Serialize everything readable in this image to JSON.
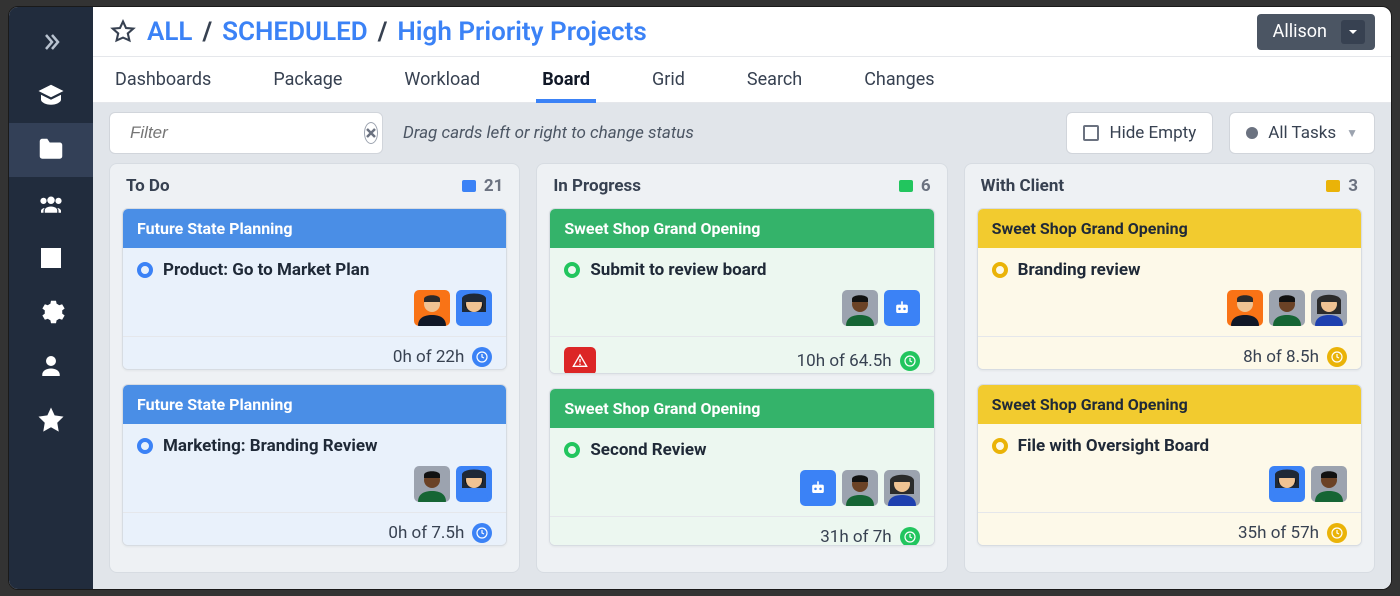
{
  "breadcrumb": {
    "item1": "ALL",
    "item2": "SCHEDULED",
    "item3": "High Priority Projects"
  },
  "user": {
    "name": "Allison"
  },
  "tabs": [
    "Dashboards",
    "Package",
    "Workload",
    "Board",
    "Grid",
    "Search",
    "Changes"
  ],
  "activeTab": 3,
  "toolbar": {
    "filter_placeholder": "Filter",
    "hint": "Drag cards left or right to change status",
    "hide_empty": "Hide Empty",
    "all_tasks": "All Tasks"
  },
  "columns": [
    {
      "title": "To Do",
      "count": "21",
      "color": "#3b82f6",
      "cards": [
        {
          "project": "Future State Planning",
          "header_bg": "#4a8ee6",
          "body_bg": "#e9f1fb",
          "task": "Product: Go to Market Plan",
          "ring_color": "#3b82f6",
          "avatars": [
            "man-suit-orange",
            "woman-sunglasses"
          ],
          "footer_alert": false,
          "hours": "0h of 22h",
          "clock_color": "#3b82f6"
        },
        {
          "project": "Future State Planning",
          "header_bg": "#4a8ee6",
          "body_bg": "#e9f1fb",
          "task": "Marketing: Branding Review",
          "ring_color": "#3b82f6",
          "avatars": [
            "man-dark",
            "woman-sunglasses"
          ],
          "footer_alert": false,
          "hours": "0h of 7.5h",
          "clock_color": "#3b82f6"
        }
      ]
    },
    {
      "title": "In Progress",
      "count": "6",
      "color": "#22c55e",
      "cards": [
        {
          "project": "Sweet Shop Grand Opening",
          "header_bg": "#34b36a",
          "body_bg": "#ecf7f0",
          "task": "Submit to review board",
          "ring_color": "#22c55e",
          "avatars": [
            "man-dark",
            "bot"
          ],
          "footer_alert": true,
          "hours": "10h of 64.5h",
          "clock_color": "#22c55e"
        },
        {
          "project": "Sweet Shop Grand Opening",
          "header_bg": "#34b36a",
          "body_bg": "#ecf7f0",
          "task": "Second Review",
          "ring_color": "#22c55e",
          "avatars": [
            "bot",
            "man-dark",
            "woman-light"
          ],
          "footer_alert": false,
          "hours": "31h of 7h",
          "clock_color": "#22c55e"
        }
      ]
    },
    {
      "title": "With Client",
      "count": "3",
      "color": "#eab308",
      "cards": [
        {
          "project": "Sweet Shop Grand Opening",
          "header_bg": "#f2cb2f",
          "body_bg": "#fdf9e9",
          "header_text": "#1f2937",
          "task": "Branding review",
          "ring_color": "#eab308",
          "avatars": [
            "man-suit-orange",
            "man-dark",
            "woman-light"
          ],
          "footer_alert": false,
          "hours": "8h of 8.5h",
          "clock_color": "#eab308"
        },
        {
          "project": "Sweet Shop Grand Opening",
          "header_bg": "#f2cb2f",
          "body_bg": "#fdf9e9",
          "header_text": "#1f2937",
          "task": "File with Oversight Board",
          "ring_color": "#eab308",
          "avatars": [
            "woman-sunglasses",
            "man-dark"
          ],
          "footer_alert": false,
          "hours": "35h of 57h",
          "clock_color": "#eab308"
        }
      ]
    }
  ]
}
